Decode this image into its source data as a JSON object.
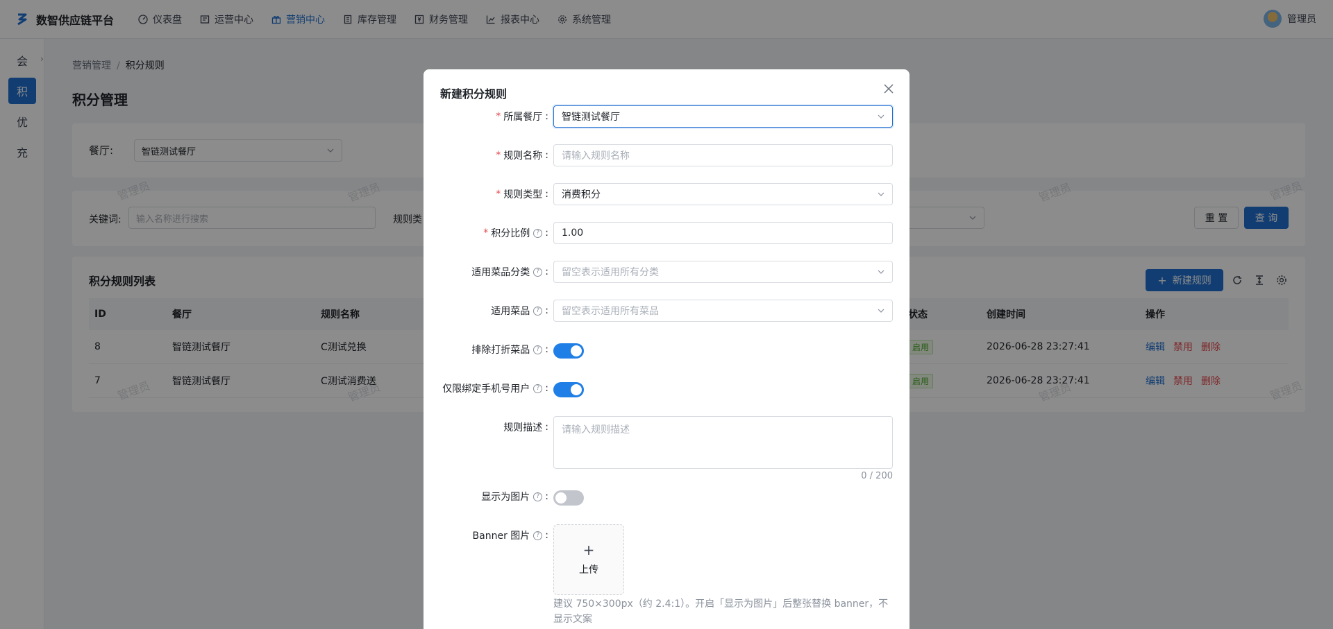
{
  "app": {
    "title": "数智供应链平台"
  },
  "topnav": {
    "items": [
      {
        "label": "仪表盘",
        "icon": "dashboard-icon"
      },
      {
        "label": "运营中心",
        "icon": "operations-icon"
      },
      {
        "label": "营销中心",
        "icon": "gift-icon",
        "active": true
      },
      {
        "label": "库存管理",
        "icon": "inventory-icon"
      },
      {
        "label": "财务管理",
        "icon": "finance-icon"
      },
      {
        "label": "报表中心",
        "icon": "chart-icon"
      },
      {
        "label": "系统管理",
        "icon": "settings-icon"
      }
    ],
    "user": "管理员"
  },
  "rail": {
    "items": [
      {
        "label": "会"
      },
      {
        "label": "积",
        "active": true
      },
      {
        "label": "优"
      },
      {
        "label": "充"
      }
    ],
    "expand": "›"
  },
  "breadcrumb": {
    "parent": "营销管理",
    "sep": "/",
    "current": "积分规则"
  },
  "page": {
    "title": "积分管理"
  },
  "filter": {
    "restaurant_label": "餐厅:",
    "restaurant_value": "智链测试餐厅",
    "keyword_label": "关键词:",
    "keyword_placeholder": "输入名称进行搜索",
    "rule_type_label": "规则类",
    "reset": "重 置",
    "query": "查 询"
  },
  "list": {
    "title": "积分规则列表",
    "new_button": "新建规则",
    "columns": {
      "id": "ID",
      "restaurant": "餐厅",
      "name": "规则名称",
      "status": "状态",
      "created": "创建时间",
      "actions": "操作"
    },
    "rows": [
      {
        "id": "8",
        "restaurant": "智链测试餐厅",
        "name": "C测试兑换",
        "status": "启用",
        "created": "2026-06-28 23:27:41"
      },
      {
        "id": "7",
        "restaurant": "智链测试餐厅",
        "name": "C测试消费送",
        "status": "启用",
        "created": "2026-06-28 23:27:41"
      }
    ],
    "actions": {
      "edit": "编辑",
      "disable": "禁用",
      "delete": "删除"
    }
  },
  "watermark": "管理员",
  "modal": {
    "title": "新建积分规则",
    "fields": {
      "restaurant": {
        "label": "所属餐厅",
        "value": "智链测试餐厅"
      },
      "name": {
        "label": "规则名称",
        "placeholder": "请输入规则名称"
      },
      "type": {
        "label": "规则类型",
        "value": "消费积分"
      },
      "ratio": {
        "label": "积分比例",
        "value": "1.00"
      },
      "category": {
        "label": "适用菜品分类",
        "placeholder": "留空表示适用所有分类"
      },
      "dishes": {
        "label": "适用菜品",
        "placeholder": "留空表示适用所有菜品"
      },
      "exclude_discount": {
        "label": "排除打折菜品",
        "on": true
      },
      "phone_only": {
        "label": "仅限绑定手机号用户",
        "on": true
      },
      "description": {
        "label": "规则描述",
        "placeholder": "请输入规则描述",
        "counter": "0 / 200"
      },
      "show_as_image": {
        "label": "显示为图片",
        "on": false
      },
      "banner": {
        "label": "Banner 图片",
        "upload": "上传",
        "hint": "建议 750×300px（约 2.4:1）。开启「显示为图片」后整张替换 banner，不显示文案"
      }
    }
  },
  "colors": {
    "primary": "#1f6fd0",
    "danger": "#e5484d",
    "success": "#4aa829"
  }
}
